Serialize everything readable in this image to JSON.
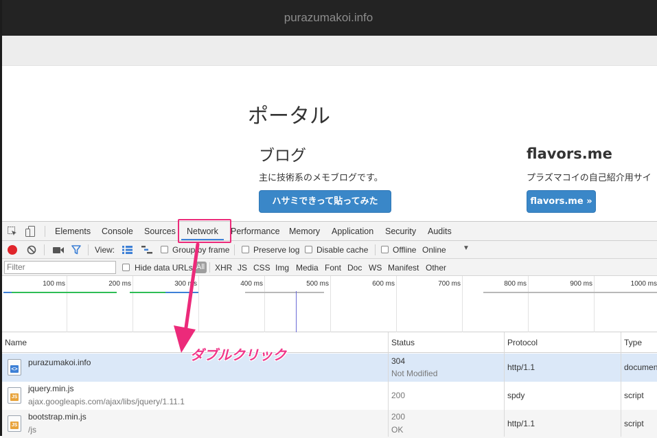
{
  "window": {
    "title": "purazumakoi.info"
  },
  "page": {
    "heading": "ポータル",
    "sections": [
      {
        "title": "ブログ",
        "text": "主に技術系のメモブログです。",
        "button": "ハサミできって貼ってみた"
      },
      {
        "title": "flavors.me",
        "text": "プラズマコイの自己紹介用サイ",
        "button": "flavors.me »"
      }
    ]
  },
  "devtools": {
    "tabs": [
      "Elements",
      "Console",
      "Sources",
      "Network",
      "Performance",
      "Memory",
      "Application",
      "Security",
      "Audits"
    ],
    "active_tab": "Network",
    "toolbar": {
      "view_label": "View:",
      "group_by_frame": "Group by frame",
      "preserve_log": "Preserve log",
      "disable_cache": "Disable cache",
      "offline": "Offline",
      "throttle": "Online"
    },
    "filter": {
      "placeholder": "Filter",
      "hide_data_urls": "Hide data URLs",
      "all": "All",
      "types": [
        "XHR",
        "JS",
        "CSS",
        "Img",
        "Media",
        "Font",
        "Doc",
        "WS",
        "Manifest",
        "Other"
      ]
    },
    "overview_ticks": [
      "100 ms",
      "200 ms",
      "300 ms",
      "400 ms",
      "500 ms",
      "600 ms",
      "700 ms",
      "800 ms",
      "900 ms",
      "1000 ms"
    ],
    "columns": [
      "Name",
      "Status",
      "Protocol",
      "Type"
    ],
    "rows": [
      {
        "name": "purazumakoi.info",
        "path": "",
        "status": "304",
        "status_text": "Not Modified",
        "protocol": "http/1.1",
        "type": "documen",
        "icon": "html-doc-icon"
      },
      {
        "name": "jquery.min.js",
        "path": "ajax.googleapis.com/ajax/libs/jquery/1.11.1",
        "status": "200",
        "status_text": "",
        "protocol": "spdy",
        "type": "script",
        "icon": "js-file-icon"
      },
      {
        "name": "bootstrap.min.js",
        "path": "/js",
        "status": "200",
        "status_text": "OK",
        "protocol": "http/1.1",
        "type": "script",
        "icon": "js-file-icon"
      }
    ]
  },
  "annotation": {
    "text": "ダブルクリック",
    "color": "#ec2a7a"
  },
  "colors": {
    "record": "#e0252b",
    "filter_active": "#3d80d6",
    "selected_row": "#dbe8f8",
    "button": "#3a87c8"
  }
}
